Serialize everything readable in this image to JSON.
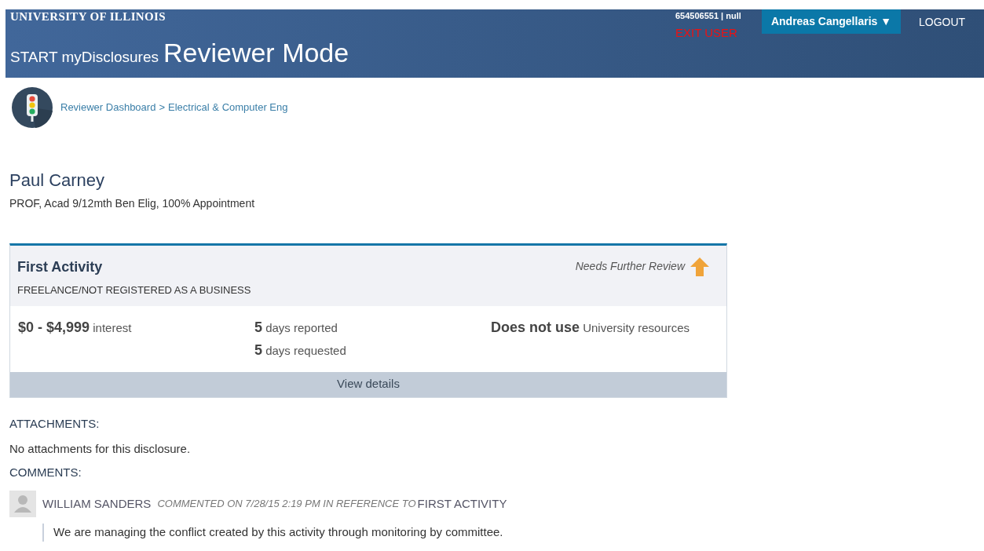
{
  "header": {
    "university": "UNIVERSITY OF ILLINOIS",
    "app": "START myDisclosures",
    "mode": "Reviewer Mode",
    "user_id": "654506551 | null",
    "exit": "EXIT USER",
    "user_menu": "Andreas Cangellaris ▼",
    "logout": "LOGOUT"
  },
  "breadcrumb": [
    {
      "label": "Reviewer Dashboard"
    },
    {
      "label": ">"
    },
    {
      "label": "Electrical & Computer Eng"
    }
  ],
  "person": {
    "name": "Paul Carney",
    "position": "PROF, Acad 9/12mth Ben Elig, 100% Appointment"
  },
  "activity": {
    "title": "First Activity",
    "type": "FREELANCE/NOT REGISTERED AS A BUSINESS",
    "status": "Needs Further Review",
    "interest": "**$0 - $4,999** interest",
    "days": [
      "**5** days reported",
      "**5** days requested"
    ],
    "resources": "**Does not use** University resources",
    "details": "View details"
  },
  "attachments": {
    "heading": "ATTACHMENTS:",
    "text": "No attachments for this disclosure."
  },
  "comments": {
    "heading": "COMMENTS:",
    "items": [
      {
        "author": "WILLIAM SANDERS",
        "meta": "COMMENTED ON 7/28/15 2:19 PM IN REFERENCE TO",
        "reference": "FIRST ACTIVITY",
        "text": "We are managing the conflict created by this activity through monitoring by committee."
      }
    ]
  }
}
